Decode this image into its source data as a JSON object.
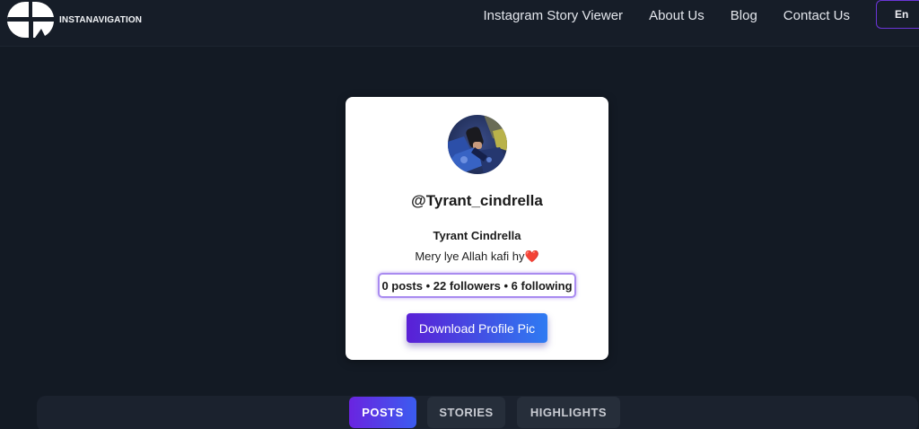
{
  "brand": {
    "name": "INSTANAVIGATION",
    "logo_icon": "brand-logo-icon"
  },
  "nav": {
    "links": [
      {
        "label": "Instagram Story Viewer"
      },
      {
        "label": "About Us"
      },
      {
        "label": "Blog"
      },
      {
        "label": "Contact Us"
      }
    ],
    "language_label": "En"
  },
  "profile": {
    "username": "@Tyrant_cindrella",
    "full_name": "Tyrant Cindrella",
    "bio": "Mery lye Allah kafi hy",
    "bio_emoji": "❤️",
    "stats": "0 posts • 22 followers • 6 following",
    "download_label": "Download Profile Pic"
  },
  "tabs": [
    {
      "label": "POSTS",
      "active": true
    },
    {
      "label": "STORIES",
      "active": false
    },
    {
      "label": "HIGHLIGHTS",
      "active": false
    }
  ],
  "colors": {
    "page_background": "#131a24",
    "accent_gradient_start": "#5a1fd6",
    "accent_gradient_end": "#2f7bf2",
    "stats_border": "#a98bf0"
  }
}
